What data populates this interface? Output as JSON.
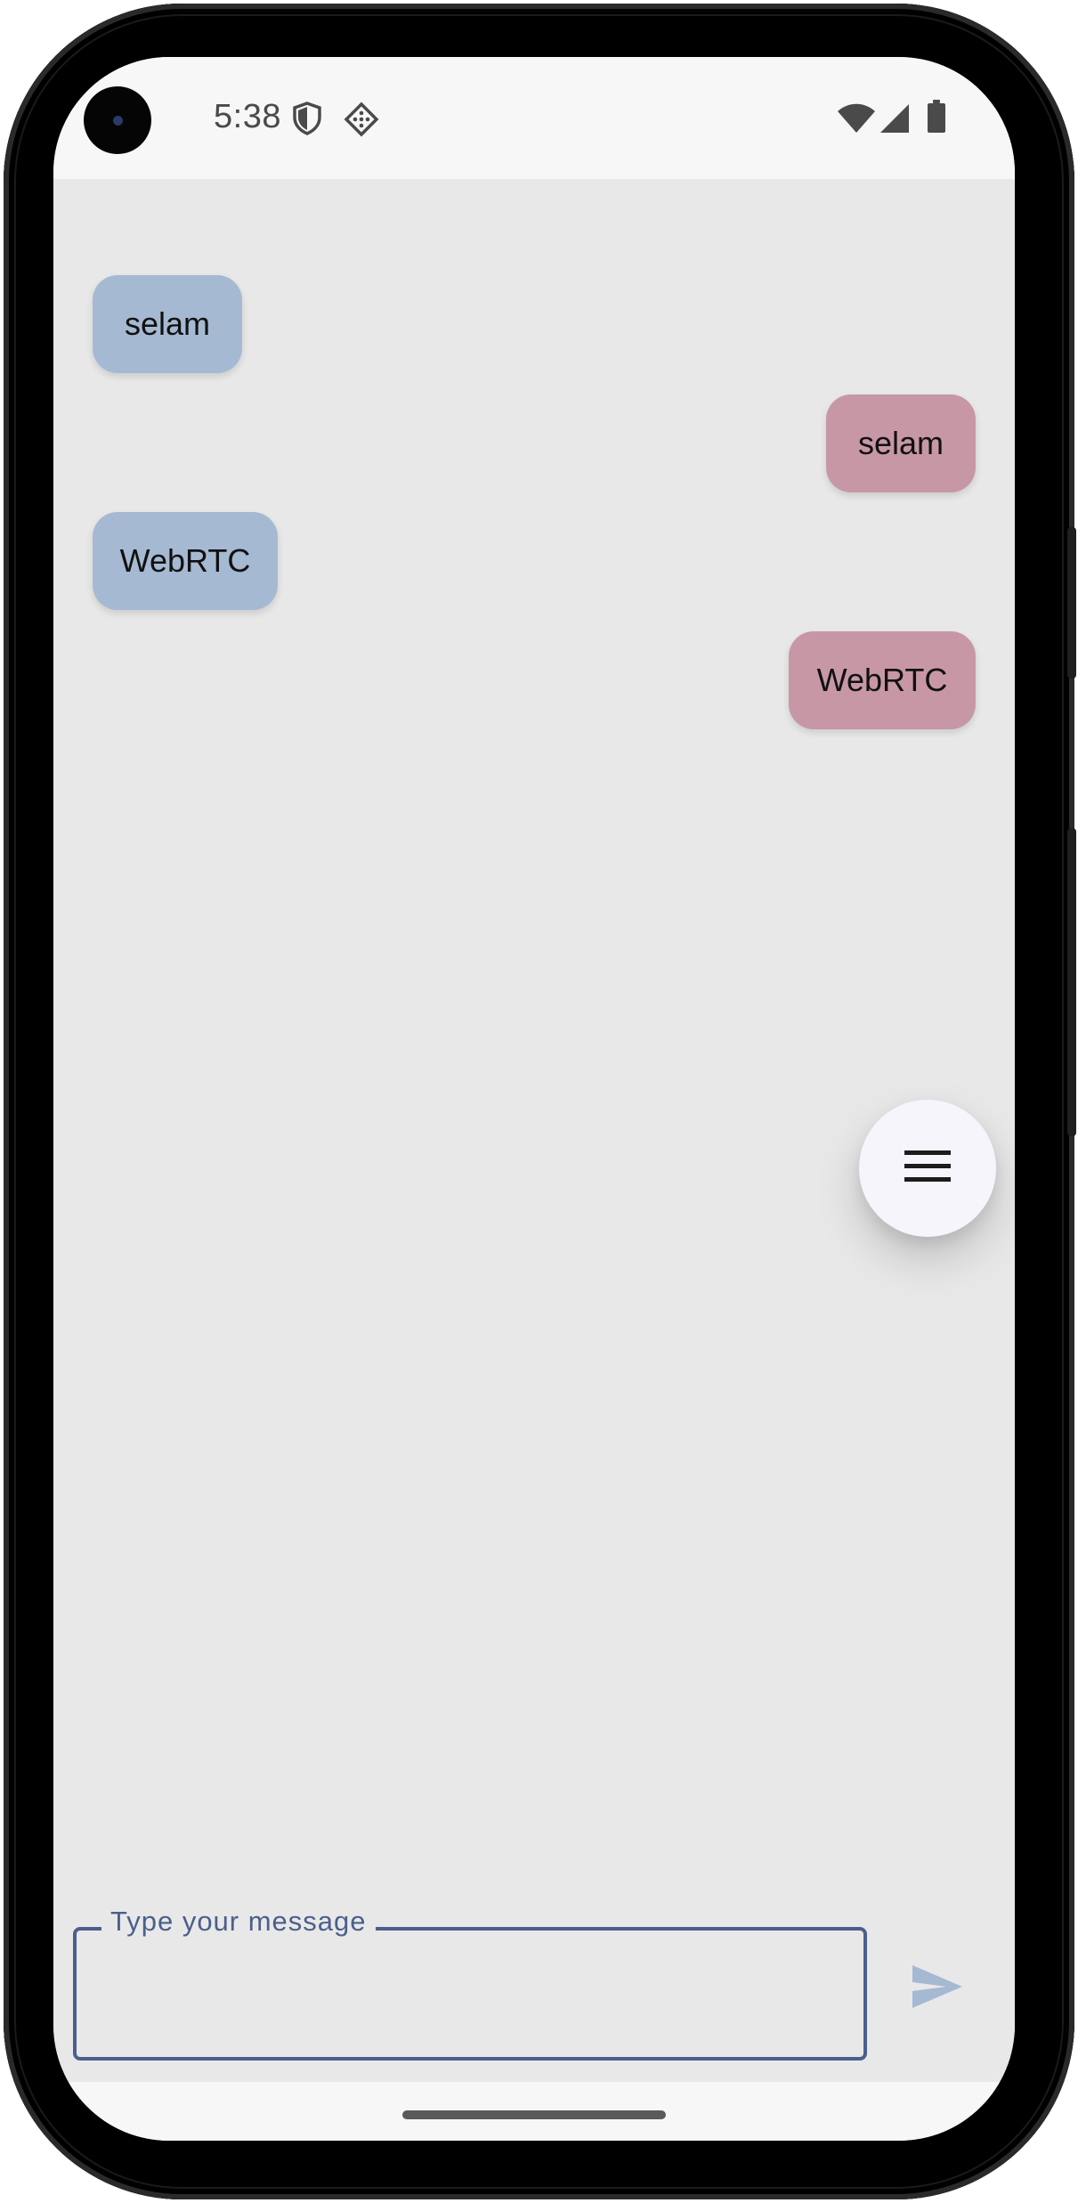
{
  "status_bar": {
    "time": "5:38",
    "left_icons": [
      "shield-icon",
      "dot-grid-diamond-icon"
    ],
    "right_icons": [
      "wifi-icon",
      "cellular-signal-icon",
      "battery-icon"
    ]
  },
  "messages": [
    {
      "text": "selam",
      "direction": "received"
    },
    {
      "text": "selam",
      "direction": "sent"
    },
    {
      "text": "WebRTC",
      "direction": "received"
    },
    {
      "text": "WebRTC",
      "direction": "sent"
    }
  ],
  "fab": {
    "icon": "menu-icon"
  },
  "composer": {
    "label": "Type your message",
    "value": "",
    "send_icon": "send-icon"
  },
  "colors": {
    "received_bubble": "#a6b9d3",
    "sent_bubble": "#c897a6",
    "background": "#e8e8e8",
    "accent": "#4b5f8c",
    "send_icon": "#a6b9d3"
  }
}
